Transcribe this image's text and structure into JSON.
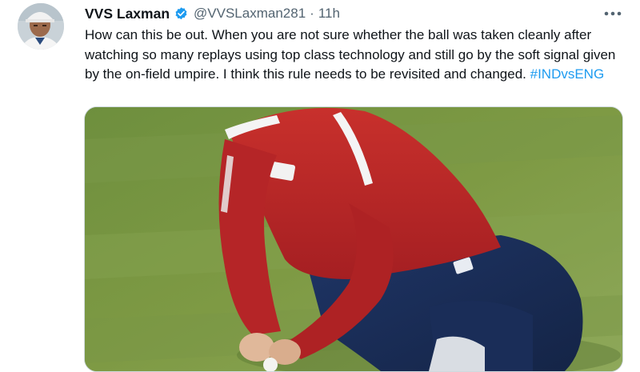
{
  "tweet": {
    "author_name": "VVS Laxman",
    "verified": true,
    "handle": "@VVSLaxman281",
    "separator": "·",
    "time": "11h",
    "text_before": "How can this be out. When you are not sure whether the ball was taken cleanly after watching so many replays using top class technology and still go by the soft signal given by the on-field umpire. I think this rule needs to be revisited and changed. ",
    "hashtag": "#INDvsENG"
  },
  "icons": {
    "verified": "verified-badge-icon",
    "more": "more-options-icon"
  },
  "colors": {
    "link": "#1d9bf0",
    "secondary_text": "#536471",
    "verified": "#1d9bf0",
    "border": "#cfd9de"
  }
}
